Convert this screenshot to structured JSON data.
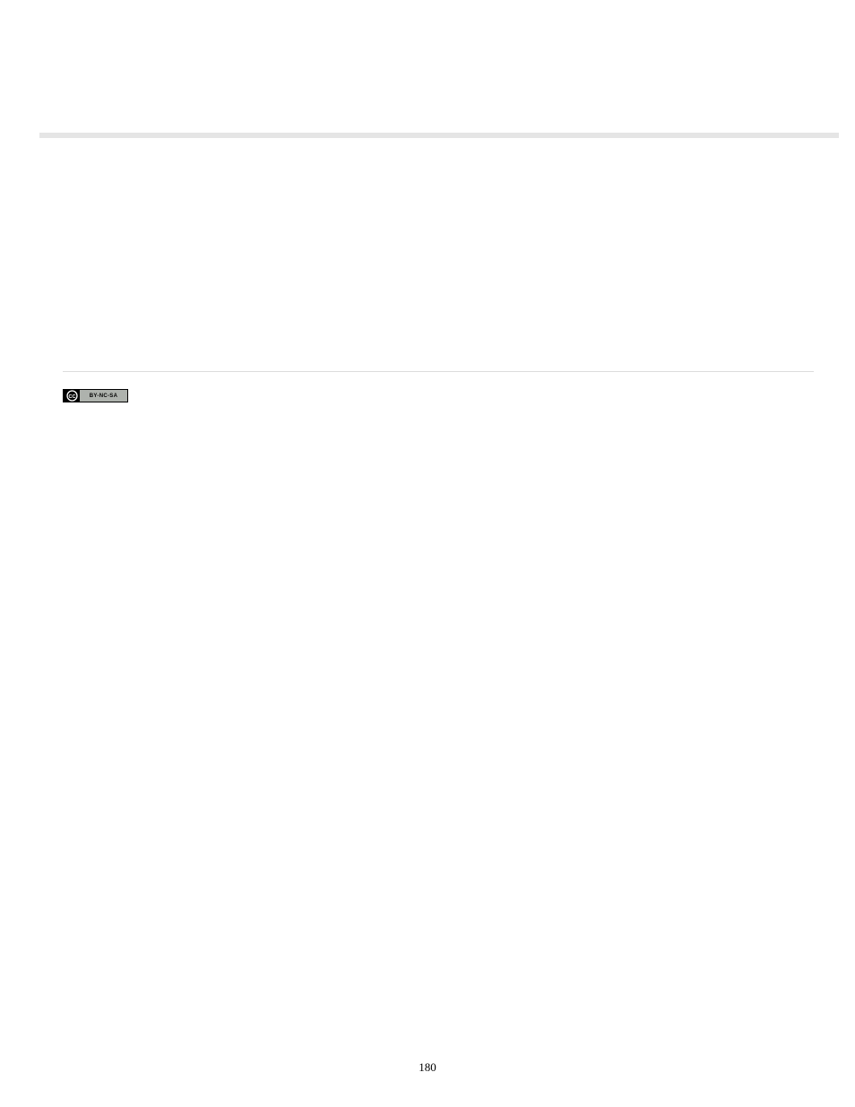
{
  "license": {
    "cc_label": "CC",
    "terms_label": "BY-NC-SA"
  },
  "page_number": "180"
}
